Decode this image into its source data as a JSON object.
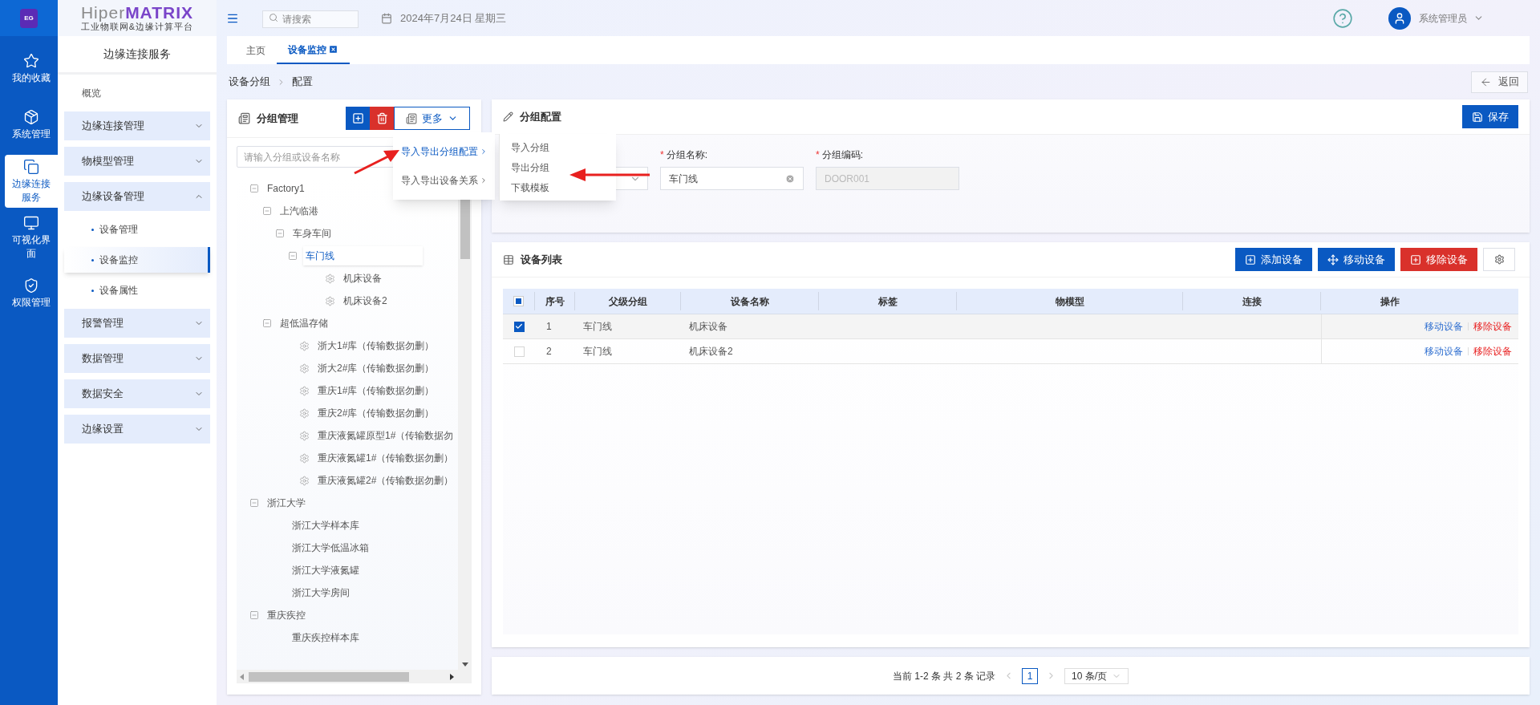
{
  "rail": {
    "logo": "EG",
    "items": [
      {
        "label": "我的收藏",
        "selected": false
      },
      {
        "label": "系统管理",
        "selected": false
      },
      {
        "label": "边缘连接服务",
        "selected": true
      },
      {
        "label": "可视化界面",
        "selected": false
      },
      {
        "label": "权限管理",
        "selected": false
      }
    ]
  },
  "brand": {
    "name_plain": "Hiper",
    "name_bold": "MATRIX",
    "tagline": "工业物联网&边缘计算平台"
  },
  "sidebar": {
    "title": "边缘连接服务",
    "items": [
      {
        "kind": "link",
        "label": "概览"
      },
      {
        "kind": "group",
        "label": "边缘连接管理",
        "expanded": false
      },
      {
        "kind": "group",
        "label": "物模型管理",
        "expanded": false
      },
      {
        "kind": "group",
        "label": "边缘设备管理",
        "expanded": true,
        "children": [
          {
            "label": "设备管理",
            "selected": false
          },
          {
            "label": "设备监控",
            "selected": true
          },
          {
            "label": "设备属性",
            "selected": false
          }
        ]
      },
      {
        "kind": "group",
        "label": "报警管理",
        "expanded": false
      },
      {
        "kind": "group",
        "label": "数据管理",
        "expanded": false
      },
      {
        "kind": "group",
        "label": "数据安全",
        "expanded": false
      },
      {
        "kind": "group",
        "label": "边缘设置",
        "expanded": false
      }
    ]
  },
  "topbar": {
    "search": {
      "placeholder": "请搜索"
    },
    "date": "2024年7月24日 星期三",
    "user": "系统管理员"
  },
  "tabs": [
    {
      "label": "主页",
      "selected": false,
      "closable": false
    },
    {
      "label": "设备监控",
      "selected": true,
      "closable": true
    }
  ],
  "breadcrumb": [
    "设备分组",
    "配置"
  ],
  "back_button": "返回",
  "group_panel": {
    "title": "分组管理",
    "more_button": "更多",
    "search": {
      "placeholder": "请输入分组或设备名称"
    },
    "tree": [
      {
        "kind": "group",
        "label": "Factory1",
        "expanded": true,
        "selected": false,
        "children": [
          {
            "kind": "group",
            "label": "上汽临港",
            "expanded": true,
            "selected": false,
            "children": [
              {
                "kind": "group",
                "label": "车身车间",
                "expanded": true,
                "selected": false,
                "children": [
                  {
                    "kind": "group",
                    "label": "车门线",
                    "expanded": true,
                    "selected": true,
                    "children": [
                      {
                        "kind": "device",
                        "label": "机床设备",
                        "selected": false
                      },
                      {
                        "kind": "device",
                        "label": "机床设备2",
                        "selected": false
                      }
                    ]
                  }
                ]
              }
            ]
          },
          {
            "kind": "group",
            "label": "超低温存储",
            "expanded": true,
            "selected": false,
            "children": [
              {
                "kind": "device",
                "label": "浙大1#库（传输数据勿删）",
                "selected": false
              },
              {
                "kind": "device",
                "label": "浙大2#库（传输数据勿删）",
                "selected": false
              },
              {
                "kind": "device",
                "label": "重庆1#库（传输数据勿删）",
                "selected": false
              },
              {
                "kind": "device",
                "label": "重庆2#库（传输数据勿删）",
                "selected": false
              },
              {
                "kind": "device",
                "label": "重庆液氮罐原型1#（传输数据勿",
                "selected": false
              },
              {
                "kind": "device",
                "label": "重庆液氮罐1#（传输数据勿删）",
                "selected": false
              },
              {
                "kind": "device",
                "label": "重庆液氮罐2#（传输数据勿删）",
                "selected": false
              }
            ]
          }
        ]
      },
      {
        "kind": "group",
        "label": "浙江大学",
        "expanded": true,
        "selected": false,
        "children": [
          {
            "kind": "plain",
            "label": "浙江大学样本库",
            "selected": false
          },
          {
            "kind": "plain",
            "label": "浙江大学低温冰箱",
            "selected": false
          },
          {
            "kind": "plain",
            "label": "浙江大学液氮罐",
            "selected": false
          },
          {
            "kind": "plain",
            "label": "浙江大学房间",
            "selected": false
          }
        ]
      },
      {
        "kind": "group",
        "label": "重庆疾控",
        "expanded": true,
        "selected": false,
        "children": [
          {
            "kind": "plain",
            "label": "重庆疾控样本库",
            "selected": false
          }
        ]
      }
    ]
  },
  "menu": {
    "items": [
      {
        "label": "导入导出分组配置",
        "selected": true
      },
      {
        "label": "导入导出设备关系",
        "selected": false
      }
    ],
    "submenu": [
      "导入分组",
      "导出分组",
      "下载模板"
    ]
  },
  "config_panel": {
    "title": "分组配置",
    "save_button": "保存",
    "fields": [
      {
        "kind": "select",
        "disabled": false
      },
      {
        "kind": "text",
        "label": "分组名称:",
        "required_mark": "*",
        "value": "车门线",
        "clearable": true,
        "disabled": false
      },
      {
        "kind": "text",
        "label": "分组编码:",
        "required_mark": "*",
        "value": "DOOR001",
        "clearable": false,
        "disabled": true
      }
    ]
  },
  "device_panel": {
    "title": "设备列表",
    "buttons": [
      {
        "label": "添加设备",
        "kind": "primary"
      },
      {
        "label": "移动设备",
        "kind": "primary"
      },
      {
        "label": "移除设备",
        "kind": "danger"
      }
    ],
    "table": {
      "select_all": {
        "checked": false,
        "indeterminate": true
      },
      "columns": [
        "序号",
        "父级分组",
        "设备名称",
        "标签",
        "物模型",
        "连接",
        "操作"
      ],
      "rows": [
        {
          "checked": true,
          "index": "1",
          "parent": "车门线",
          "name": "机床设备",
          "actions": [
            {
              "label": "移动设备",
              "kind": "link"
            },
            {
              "label": "移除设备",
              "kind": "danger"
            }
          ]
        },
        {
          "checked": false,
          "index": "2",
          "parent": "车门线",
          "name": "机床设备2",
          "actions": [
            {
              "label": "移动设备",
              "kind": "link"
            },
            {
              "label": "移除设备",
              "kind": "danger"
            }
          ]
        }
      ]
    }
  },
  "pagination": {
    "summary": "当前 1-2 条 共 2 条 记录",
    "pages": [
      {
        "label": "1",
        "selected": true
      }
    ],
    "page_size": "10 条/页"
  }
}
